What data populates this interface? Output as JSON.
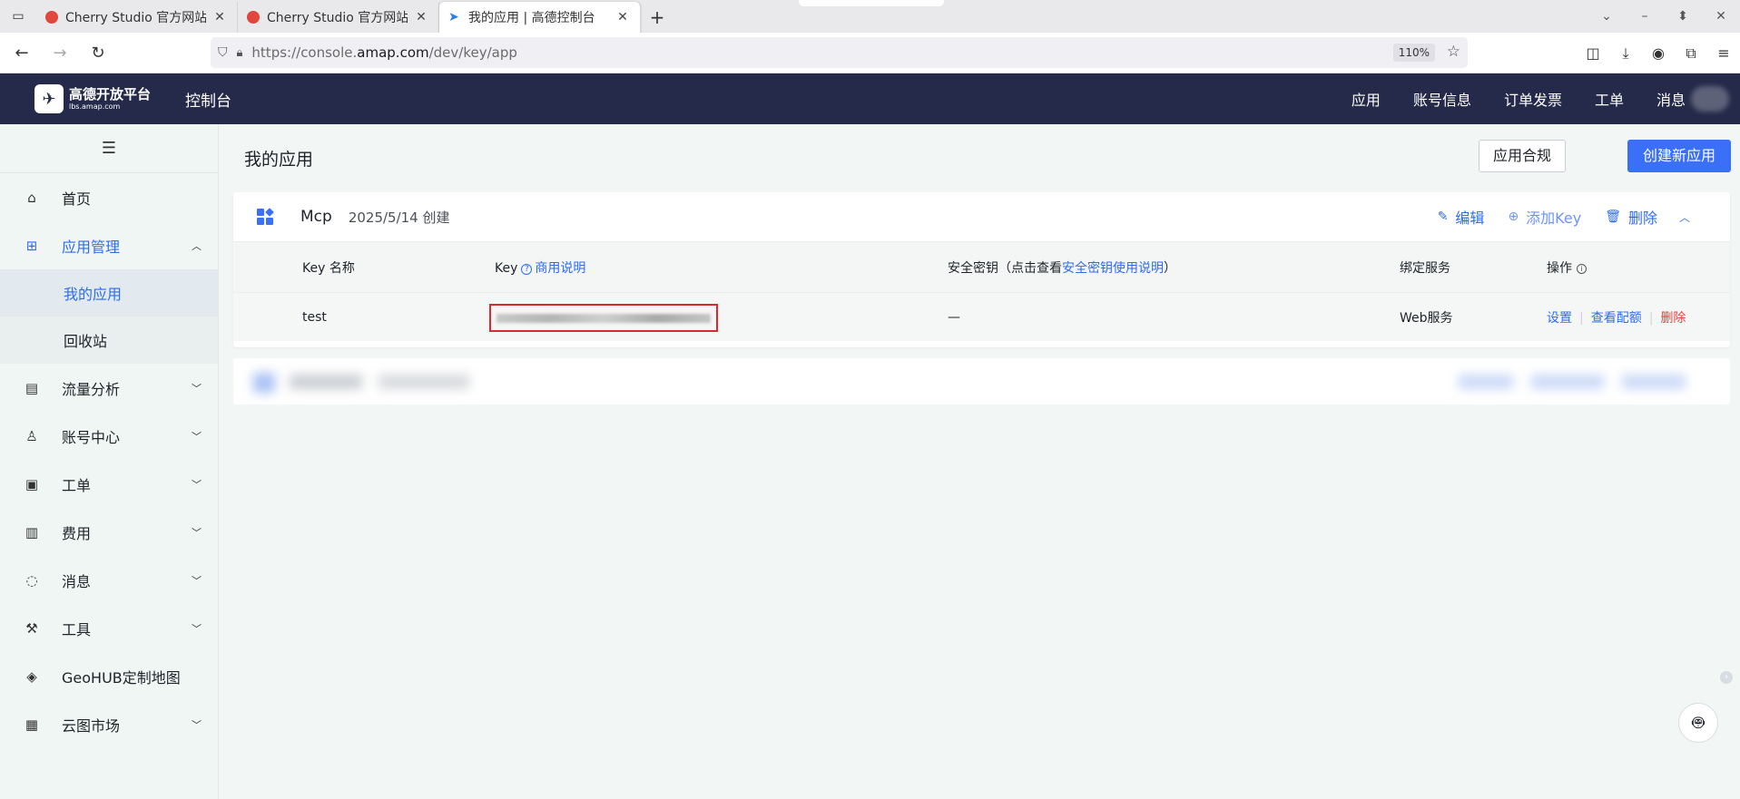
{
  "browser": {
    "tabs": [
      {
        "title": "Cherry Studio 官方网站 - 全",
        "active": false
      },
      {
        "title": "Cherry Studio 官方网站 - 全",
        "active": false
      },
      {
        "title": "我的应用 | 高德控制台",
        "active": true
      }
    ],
    "url_prefix": "https://console.",
    "url_domain": "amap.com",
    "url_path": "/dev/key/app",
    "zoom": "110%"
  },
  "header": {
    "logo_main": "高德开放平台",
    "logo_sub": "lbs.amap.com",
    "console": "控制台",
    "menu": [
      "应用",
      "账号信息",
      "订单发票",
      "工单",
      "消息"
    ]
  },
  "sidebar": {
    "items": [
      {
        "label": "首页",
        "icon": "home-icon"
      },
      {
        "label": "应用管理",
        "icon": "grid-icon"
      },
      {
        "label": "流量分析",
        "icon": "chart-icon"
      },
      {
        "label": "账号中心",
        "icon": "user-icon"
      },
      {
        "label": "工单",
        "icon": "clipboard-icon"
      },
      {
        "label": "费用",
        "icon": "billing-icon"
      },
      {
        "label": "消息",
        "icon": "message-icon"
      },
      {
        "label": "工具",
        "icon": "wrench-icon"
      },
      {
        "label": "GeoHUB定制地图",
        "icon": "layers-icon"
      },
      {
        "label": "云图市场",
        "icon": "store-icon"
      }
    ],
    "sub_items": [
      "我的应用",
      "回收站"
    ]
  },
  "main": {
    "title": "我的应用",
    "compliance_button": "应用合规",
    "create_button": "创建新应用",
    "app": {
      "name": "Mcp",
      "created": "2025/5/14 创建",
      "actions": {
        "edit": "编辑",
        "add_key": "添加Key",
        "delete": "删除"
      },
      "table": {
        "headers": {
          "key_name": "Key 名称",
          "key": "Key",
          "key_help": "商用说明",
          "secret_prefix": "安全密钥（点击查看",
          "secret_link": "安全密钥使用说明",
          "secret_suffix": "）",
          "service": "绑定服务",
          "ops": "操作"
        },
        "rows": [
          {
            "name": "test",
            "secret": "—",
            "service": "Web服务",
            "ops": {
              "settings": "设置",
              "quota": "查看配额",
              "delete": "删除"
            }
          }
        ]
      }
    }
  },
  "colors": {
    "accent": "#3a6ff7",
    "header_bg": "#252a4a",
    "highlight_border": "#e0272c",
    "danger": "#e8433f"
  }
}
